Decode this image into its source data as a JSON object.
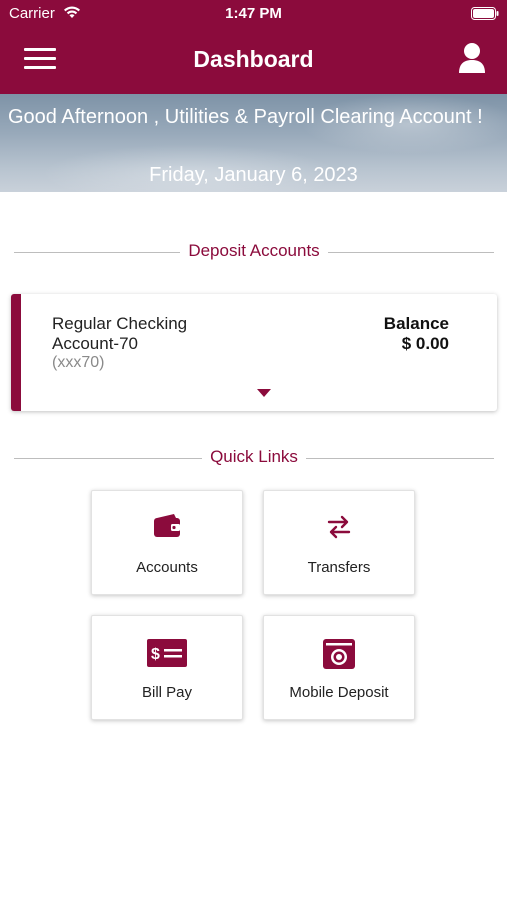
{
  "status_bar": {
    "carrier": "Carrier",
    "time": "1:47 PM"
  },
  "header": {
    "title": "Dashboard",
    "menu_icon": "hamburger-menu-icon",
    "profile_icon": "user-icon"
  },
  "hero": {
    "greeting": "Good Afternoon , Utilities & Payroll Clearing Account !",
    "date": "Friday, January 6, 2023"
  },
  "deposit_section": {
    "heading": "Deposit Accounts"
  },
  "account": {
    "name": "Regular Checking Account-70",
    "masked_number": "(xxx70)",
    "balance_label": "Balance",
    "balance_value": "$ 0.00"
  },
  "quick_links": {
    "heading": "Quick Links",
    "items": [
      {
        "label": "Accounts",
        "icon": "wallet-icon"
      },
      {
        "label": "Transfers",
        "icon": "transfer-arrows-icon"
      },
      {
        "label": "Bill Pay",
        "icon": "bill-pay-icon"
      },
      {
        "label": "Mobile Deposit",
        "icon": "mobile-deposit-camera-icon"
      }
    ]
  },
  "colors": {
    "brand": "#8b0b3c",
    "divider": "#bdbdbd",
    "muted_text": "#8a8a8a"
  }
}
